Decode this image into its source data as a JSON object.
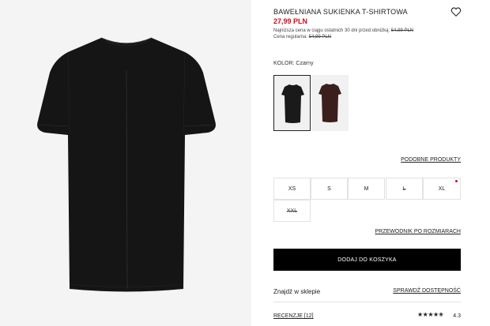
{
  "product": {
    "title": "BAWEŁNIANA SUKIENKA T-SHIRTOWA",
    "price": "27,99 PLN",
    "lowest_price_label": "Najniższa cena w ciągu ostatnich 30 dni przed obniżką: ",
    "lowest_price_value": "54,99 PLN",
    "regular_price_label": "Cena regularna: ",
    "regular_price_value": "54,99 PLN",
    "wishlist_icon": "heart-icon"
  },
  "colors": {
    "label": "KOLOR: Czarny",
    "options": [
      {
        "name": "Czarny",
        "selected": true,
        "hex": "#1a1a1a"
      },
      {
        "name": "Brązowy",
        "selected": false,
        "hex": "#3a1f1c"
      }
    ]
  },
  "links": {
    "similar": "PODOBNE PRODUKTY",
    "size_guide": "PRZEWODNIK PO ROZMIARACH",
    "availability": "SPRAWDŹ DOSTĘPNOŚĆ",
    "reviews": "RECENZJE [12]"
  },
  "sizes": [
    {
      "label": "XS",
      "available": true
    },
    {
      "label": "S",
      "available": true
    },
    {
      "label": "M",
      "available": true
    },
    {
      "label": "L",
      "available": false
    },
    {
      "label": "XL",
      "available": true,
      "low_stock": true
    },
    {
      "label": "XXL",
      "available": false
    }
  ],
  "actions": {
    "add_to_cart": "DODAJ DO KOSZYKA",
    "find_in_store": "Znajdź w sklepie"
  },
  "rating": {
    "stars_glyph": "★★★★✬",
    "value": "4.3",
    "score": 4.3
  },
  "colors_theme": {
    "sale_red": "#d10a1a",
    "button_black": "#000000",
    "image_bg": "#f4f4f4"
  }
}
